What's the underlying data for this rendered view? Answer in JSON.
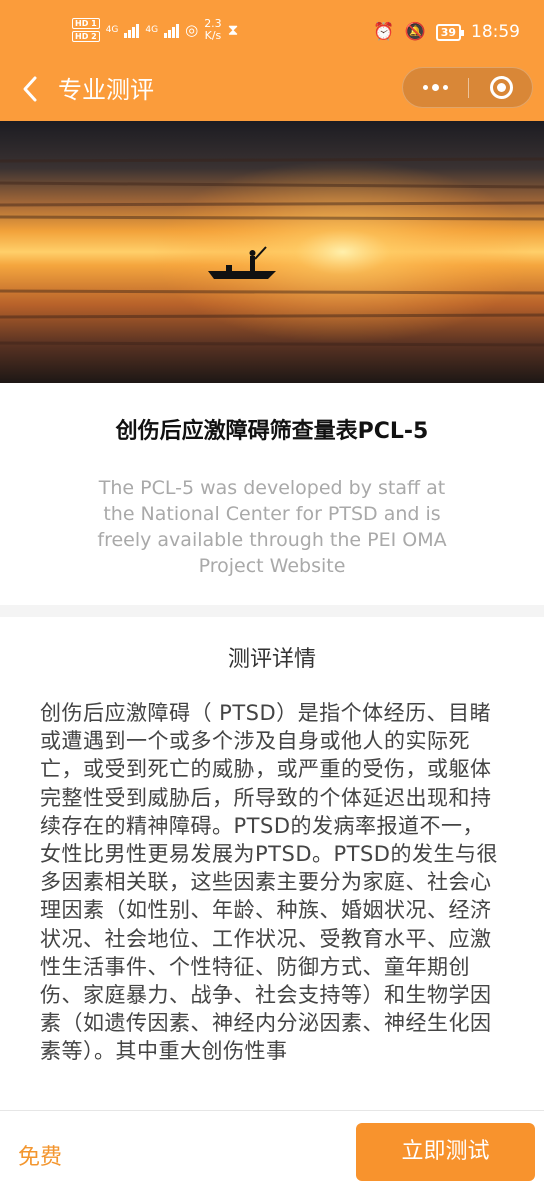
{
  "status_bar": {
    "net_speed_value": "2.3",
    "net_speed_unit": "K/s",
    "battery": "39",
    "time": "18:59",
    "hd1": "HD 1",
    "hd2": "HD 2",
    "net1": "4G",
    "net2": "4G"
  },
  "nav": {
    "back_icon": "chevron-left",
    "title": "专业测评",
    "menu_icon": "more-dots",
    "close_icon": "target-circle"
  },
  "hero": {
    "image": "sunset-over-sea-with-fisherman-boat"
  },
  "test": {
    "title": "创伤后应激障碍筛查量表PCL-5",
    "description": "The PCL-5 was developed by staff at the National Center for PTSD and is freely available through the PEI OMA Project Website"
  },
  "details": {
    "heading": "测评详情",
    "body": "创伤后应激障碍（ PTSD）是指个体经历、目睹或遭遇到一个或多个涉及自身或他人的实际死亡，或受到死亡的威胁，或严重的受伤，或躯体完整性受到威胁后，所导致的个体延迟出现和持续存在的精神障碍。PTSD的发病率报道不一，女性比男性更易发展为PTSD。PTSD的发生与很多因素相关联，这些因素主要分为家庭、社会心理因素（如性别、年龄、种族、婚姻状况、经济状况、社会地位、工作状况、受教育水平、应激性生活事件、个性特征、防御方式、童年期创伤、家庭暴力、战争、社会支持等）和生物学因素（如遗传因素、神经内分泌因素、神经生化因素等）。其中重大创伤性事"
  },
  "footer": {
    "price": "免费",
    "cta": "立即测试"
  },
  "colors": {
    "accent": "#fb9c3b",
    "button": "#f8932d",
    "price": "#f3962f"
  }
}
